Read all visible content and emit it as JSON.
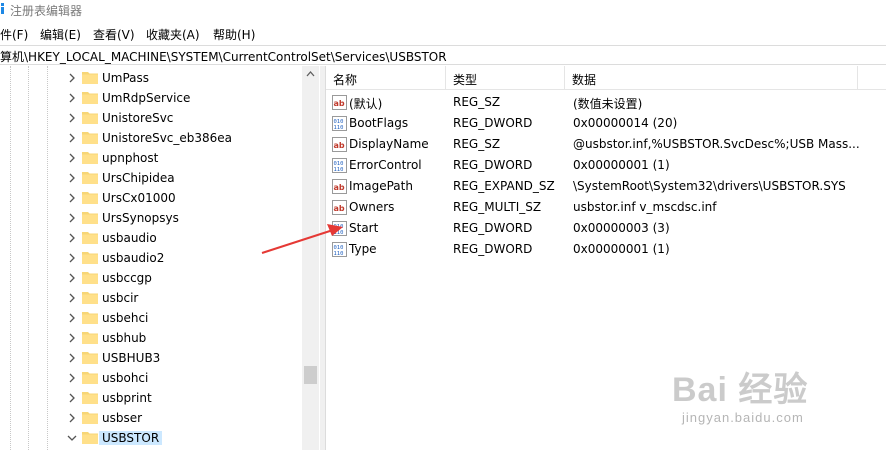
{
  "window": {
    "title": "注册表编辑器"
  },
  "menu": [
    {
      "label": "件(F)"
    },
    {
      "label": "编辑(E)"
    },
    {
      "label": "查看(V)"
    },
    {
      "label": "收藏夹(A)"
    },
    {
      "label": "帮助(H)"
    }
  ],
  "address": {
    "path": "算机\\HKEY_LOCAL_MACHINE\\SYSTEM\\CurrentControlSet\\Services\\USBSTOR"
  },
  "tree": {
    "items": [
      {
        "label": "UmPass"
      },
      {
        "label": "UmRdpService"
      },
      {
        "label": "UnistoreSvc"
      },
      {
        "label": "UnistoreSvc_eb386ea"
      },
      {
        "label": "upnphost"
      },
      {
        "label": "UrsChipidea"
      },
      {
        "label": "UrsCx01000"
      },
      {
        "label": "UrsSynopsys"
      },
      {
        "label": "usbaudio"
      },
      {
        "label": "usbaudio2"
      },
      {
        "label": "usbccgp"
      },
      {
        "label": "usbcir"
      },
      {
        "label": "usbehci"
      },
      {
        "label": "usbhub"
      },
      {
        "label": "USBHUB3"
      },
      {
        "label": "usbohci"
      },
      {
        "label": "usbprint"
      },
      {
        "label": "usbser"
      },
      {
        "label": "USBSTOR",
        "selected": true
      }
    ]
  },
  "list": {
    "columns": {
      "name": "名称",
      "type": "类型",
      "data": "数据"
    },
    "rows": [
      {
        "name": "(默认)",
        "type": "REG_SZ",
        "data": "(数值未设置)",
        "icon": "string-value-icon"
      },
      {
        "name": "BootFlags",
        "type": "REG_DWORD",
        "data": "0x00000014 (20)",
        "icon": "binary-value-icon"
      },
      {
        "name": "DisplayName",
        "type": "REG_SZ",
        "data": "@usbstor.inf,%USBSTOR.SvcDesc%;USB Mass...",
        "icon": "string-value-icon"
      },
      {
        "name": "ErrorControl",
        "type": "REG_DWORD",
        "data": "0x00000001 (1)",
        "icon": "binary-value-icon"
      },
      {
        "name": "ImagePath",
        "type": "REG_EXPAND_SZ",
        "data": "\\SystemRoot\\System32\\drivers\\USBSTOR.SYS",
        "icon": "string-value-icon"
      },
      {
        "name": "Owners",
        "type": "REG_MULTI_SZ",
        "data": "usbstor.inf v_mscdsc.inf",
        "icon": "string-value-icon"
      },
      {
        "name": "Start",
        "type": "REG_DWORD",
        "data": "0x00000003 (3)",
        "icon": "binary-value-icon"
      },
      {
        "name": "Type",
        "type": "REG_DWORD",
        "data": "0x00000001 (1)",
        "icon": "binary-value-icon"
      }
    ]
  },
  "watermark": {
    "brand": "Bai 经验",
    "url": "jingyan.baidu.com"
  },
  "colors": {
    "selection": "#cce8ff",
    "folder": "#f7d677",
    "arrow": "#e53935",
    "string_icon": "#c0392b",
    "binary_icon": "#1f5fbf"
  }
}
